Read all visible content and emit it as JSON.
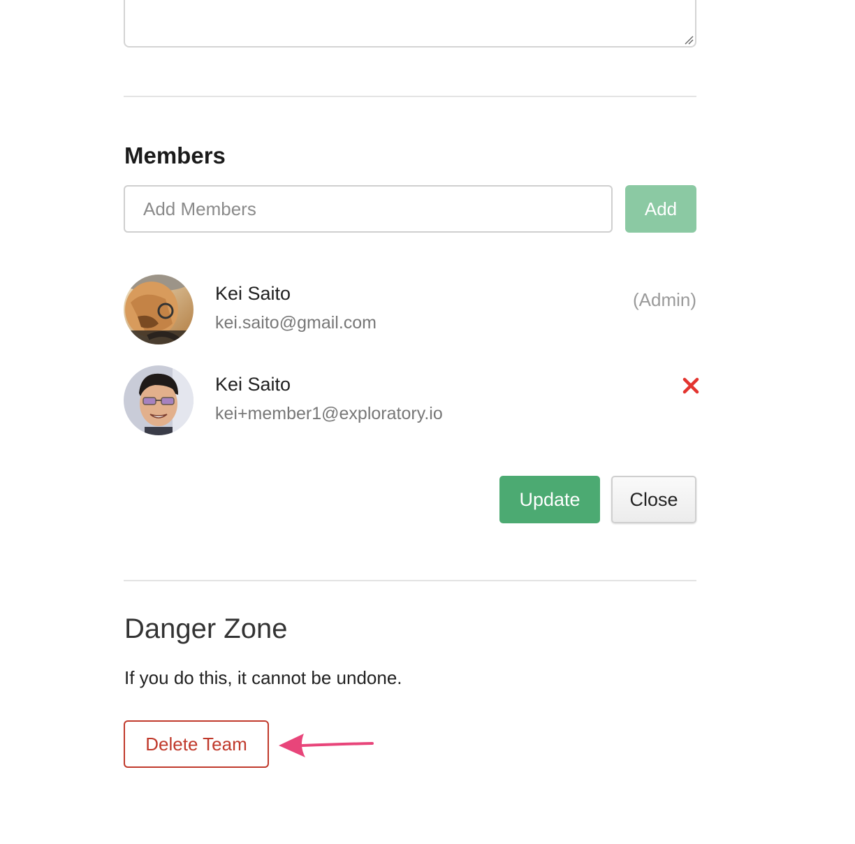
{
  "members_section": {
    "heading": "Members",
    "add_input_placeholder": "Add Members",
    "add_button_label": "Add",
    "members": [
      {
        "name": "Kei Saito",
        "email": "kei.saito@gmail.com",
        "role_label": "(Admin)",
        "avatar_icon": "person-with-cap-photo"
      },
      {
        "name": "Kei Saito",
        "email": "kei+member1@exploratory.io",
        "remove_icon": "close-x-icon",
        "avatar_icon": "smiling-person-photo"
      }
    ],
    "update_button_label": "Update",
    "close_button_label": "Close"
  },
  "danger_zone": {
    "heading": "Danger Zone",
    "warning_text": "If you do this, it cannot be undone.",
    "delete_button_label": "Delete Team"
  },
  "colors": {
    "add_button": "#8bc9a3",
    "update_button": "#4caa72",
    "danger": "#c0392b",
    "remove_icon": "#e3342f",
    "annotation_arrow": "#e8457a"
  },
  "annotation": {
    "icon": "pink-arrow-left-icon"
  }
}
